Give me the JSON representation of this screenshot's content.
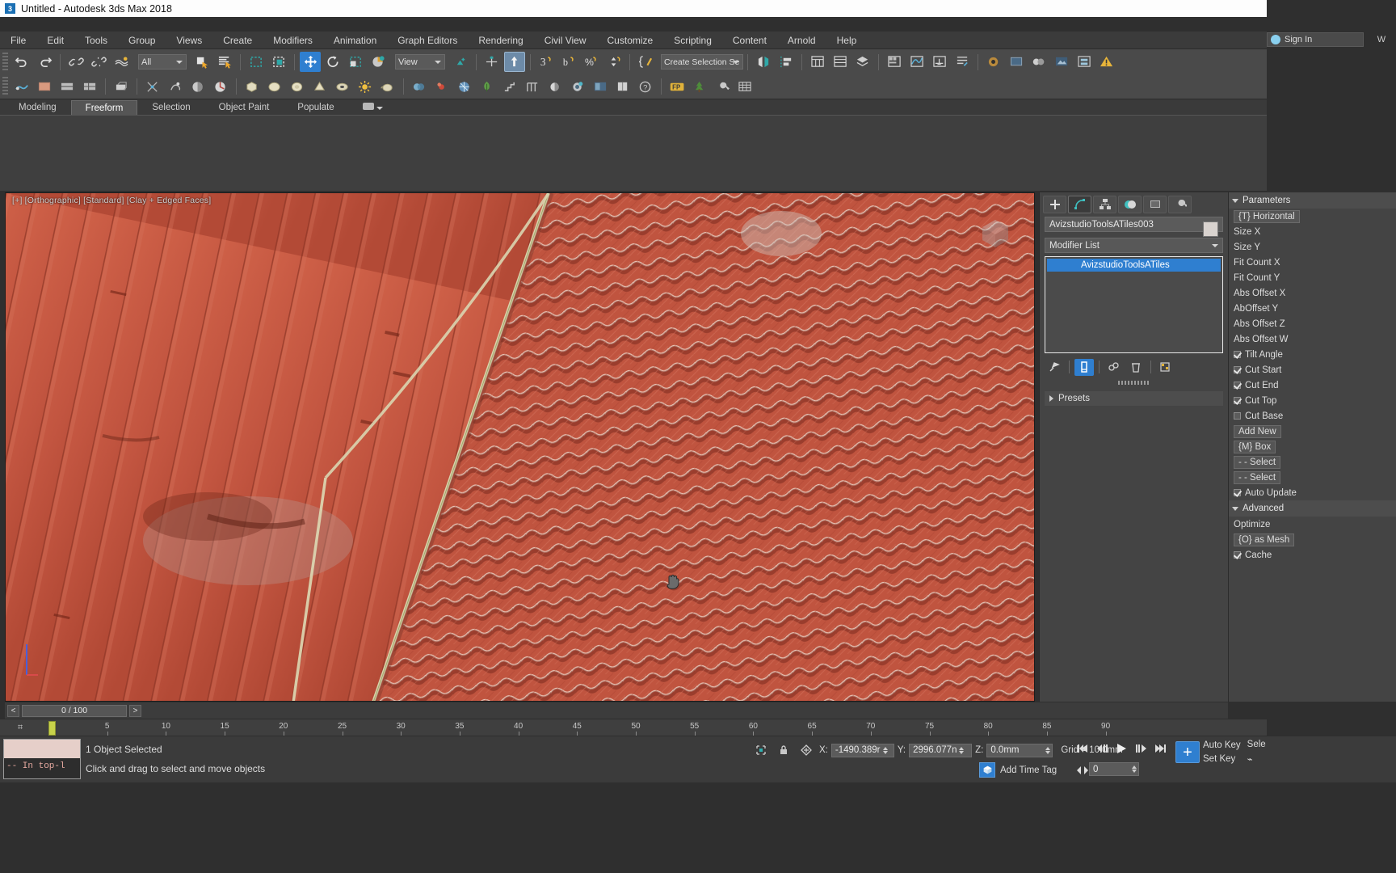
{
  "window": {
    "title": "Untitled - Autodesk 3ds Max 2018",
    "app_icon": "3ds-max-icon",
    "sign_in": "Sign In",
    "workspace_btn": "W"
  },
  "menu": {
    "items": [
      "File",
      "Edit",
      "Tools",
      "Group",
      "Views",
      "Create",
      "Modifiers",
      "Animation",
      "Graph Editors",
      "Rendering",
      "Civil View",
      "Customize",
      "Scripting",
      "Content",
      "Arnold",
      "Help"
    ]
  },
  "toolbar": {
    "selection_filter": "All",
    "reference_coord": "View",
    "named_selection_set": "Create Selection Se",
    "icons_row1": [
      "undo-icon",
      "redo-icon",
      "select-link-icon",
      "unlink-icon",
      "bind-space-warp-icon",
      "select-object-icon",
      "select-by-name-icon",
      "rectangular-selection-icon",
      "window-crossing-icon",
      "select-and-move-icon",
      "select-and-rotate-icon",
      "select-and-scale-icon",
      "placement-icon",
      "snaps-toggle-icon",
      "angle-snap-icon",
      "percent-snap-icon",
      "spinner-snap-icon",
      "edit-named-selection-icon",
      "mirror-icon",
      "align-icon",
      "layer-explorer-icon",
      "scene-explorer-icon",
      "ribbon-icon",
      "curve-editor-icon",
      "schematic-view-icon",
      "render-setup-icon",
      "render-frame-icon",
      "render-production-icon",
      "material-editor-icon",
      "quick-render-icon",
      "warning-icon"
    ],
    "icons_row2": [
      "asset-tracking-icon",
      "material-map-browser-icon",
      "layer-manager-icon",
      "light-lister-icon",
      "manage-links-icon",
      "particle-flow-icon",
      "max-script-listener-icon",
      "dope-sheet-icon",
      "box-icon",
      "sphere-icon",
      "cylinder-icon",
      "torus-icon",
      "cone-icon",
      "omni-light-icon",
      "teapot-icon",
      "compound-object-icon",
      "point-helper-icon",
      "space-warp-icon",
      "foliage-icon",
      "stairs-icon",
      "railing-icon",
      "daylight-icon",
      "camera-icon",
      "viewport-config-icon",
      "render-preview-icon",
      "help-icon",
      "fp-icon",
      "tree-icon",
      "utilities-icon",
      "grid-icon"
    ]
  },
  "ribbon": {
    "tabs": [
      {
        "label": "Modeling",
        "active": false
      },
      {
        "label": "Freeform",
        "active": true
      },
      {
        "label": "Selection",
        "active": false
      },
      {
        "label": "Object Paint",
        "active": false
      },
      {
        "label": "Populate",
        "active": false
      }
    ],
    "overflow_icon": "ribbon-overflow-icon"
  },
  "viewport": {
    "label": "[+] [Orthographic] [Standard] [Clay + Edged Faces]",
    "cursor_icon": "pan-hand-cursor",
    "viewcube_icon": "viewcube-icon",
    "axis_tripod_icon": "axis-tripod-icon",
    "colors": {
      "tile_base": "#c1543f",
      "tile_light": "#d4705b",
      "tile_dark": "#8d3425",
      "ridge_line": "#d8d4b0"
    }
  },
  "command_panel": {
    "tabs": [
      {
        "icon": "create-tab-icon",
        "active": false
      },
      {
        "icon": "modify-tab-icon",
        "active": true
      },
      {
        "icon": "hierarchy-tab-icon",
        "active": false
      },
      {
        "icon": "motion-tab-icon",
        "active": false
      },
      {
        "icon": "display-tab-icon",
        "active": false
      },
      {
        "icon": "utilities-tab-icon",
        "active": false
      }
    ],
    "object_name": "AvizstudioToolsATiles003",
    "modifier_list_label": "Modifier List",
    "modifier_stack": [
      {
        "label": "AvizstudioToolsATiles",
        "selected": true
      }
    ],
    "stack_buttons": [
      {
        "icon": "pin-stack-icon",
        "active": false
      },
      {
        "icon": "show-end-result-icon",
        "active": true
      },
      {
        "icon": "make-unique-icon",
        "active": false
      },
      {
        "icon": "remove-modifier-icon",
        "active": false
      },
      {
        "icon": "configure-modifier-sets-icon",
        "active": false
      }
    ],
    "rollouts": [
      {
        "label": "Presets",
        "expanded": false
      }
    ]
  },
  "far_panel": {
    "sections": [
      {
        "label": "Parameters",
        "expanded": true
      },
      {
        "label": "Advanced",
        "expanded": true
      }
    ],
    "rows": [
      {
        "type": "button",
        "label": "{T} Horizontal"
      },
      {
        "type": "field",
        "label": "Size X"
      },
      {
        "type": "field",
        "label": "Size Y"
      },
      {
        "type": "field",
        "label": "Fit Count X"
      },
      {
        "type": "field",
        "label": "Fit Count Y"
      },
      {
        "type": "field",
        "label": "Abs Offset X"
      },
      {
        "type": "field",
        "label": "AbOffset Y"
      },
      {
        "type": "field",
        "label": "Abs Offset Z"
      },
      {
        "type": "field",
        "label": "Abs Offset W"
      },
      {
        "type": "check",
        "label": "Tilt Angle",
        "checked": true
      },
      {
        "type": "check",
        "label": "Cut Start",
        "checked": true
      },
      {
        "type": "check",
        "label": "Cut End",
        "checked": true
      },
      {
        "type": "check",
        "label": "Cut Top",
        "checked": true
      },
      {
        "type": "check",
        "label": "Cut Base",
        "checked": false
      },
      {
        "type": "button",
        "label": "Add New"
      },
      {
        "type": "button",
        "label": "{M} Box"
      },
      {
        "type": "button",
        "label": "- - Select"
      },
      {
        "type": "button",
        "label": "- - Select"
      },
      {
        "type": "check",
        "label": "Auto Update",
        "checked": true
      },
      {
        "type": "field",
        "label": "Optimize"
      },
      {
        "type": "button",
        "label": "{O} as Mesh"
      },
      {
        "type": "check",
        "label": "Cache",
        "checked": true
      }
    ]
  },
  "trackbar": {
    "prev_label": "<",
    "next_label": ">",
    "frame_readout": "0 / 100",
    "filter_icon": "key-filter-icon"
  },
  "ruler": {
    "ticks": [
      "5",
      "10",
      "15",
      "20",
      "25",
      "30",
      "35",
      "40",
      "45",
      "50",
      "55",
      "60",
      "65",
      "70",
      "75",
      "80",
      "85",
      "90"
    ],
    "playhead_frame": 0
  },
  "status_bar": {
    "listener_text": "--  In top-l",
    "selection_status": "1 Object Selected",
    "prompt": "Click and drag to select and move objects",
    "isolate_icon": "isolate-selection-icon",
    "lock_icon": "selection-lock-icon",
    "absolute_mode_icon": "absolute-relative-mode-icon",
    "coords": [
      {
        "axis": "X:",
        "value": "-1490.389r"
      },
      {
        "axis": "Y:",
        "value": "2996.077n"
      },
      {
        "axis": "Z:",
        "value": "0.0mm"
      }
    ],
    "grid_text": "Grid = 10.0mm",
    "add_time_tag": "Add Time Tag",
    "time_tag_icon": "time-tag-icon",
    "playback": [
      {
        "icon": "go-to-start-icon"
      },
      {
        "icon": "previous-frame-icon"
      },
      {
        "icon": "play-animation-icon"
      },
      {
        "icon": "next-frame-icon"
      },
      {
        "icon": "go-to-end-icon"
      }
    ],
    "key_mode_icon": "key-mode-toggle-icon",
    "current_frame": "0",
    "set_key_button": "Set Key",
    "auto_key_button": "Auto Key",
    "big_key_icon": "set-key-icon",
    "select_list_label": "Sele"
  }
}
